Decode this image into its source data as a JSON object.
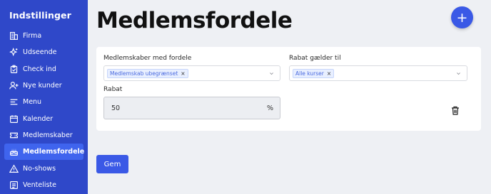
{
  "sidebar": {
    "title": "Indstillinger",
    "items": [
      {
        "label": "Firma",
        "icon": "building-icon",
        "active": false
      },
      {
        "label": "Udseende",
        "icon": "sparkle-icon",
        "active": false
      },
      {
        "label": "Check ind",
        "icon": "clipboard-check-icon",
        "active": false
      },
      {
        "label": "Nye kunder",
        "icon": "user-plus-icon",
        "active": false
      },
      {
        "label": "Menu",
        "icon": "menu-lines-icon",
        "active": false
      },
      {
        "label": "Kalender",
        "icon": "calendar-icon",
        "active": false
      },
      {
        "label": "Medlemskaber",
        "icon": "ticket-icon",
        "active": false
      },
      {
        "label": "Medlemsfordele",
        "icon": "cake-icon",
        "active": true
      },
      {
        "label": "No-shows",
        "icon": "warning-icon",
        "active": false
      },
      {
        "label": "Venteliste",
        "icon": "list-icon",
        "active": false
      }
    ]
  },
  "page": {
    "title": "Medlemsfordele",
    "add_button": "+"
  },
  "form": {
    "memberships_label": "Medlemskaber med fordele",
    "memberships_tag": "Medlemskab ubegrænset",
    "discount_scope_label": "Rabat gælder til",
    "discount_scope_tag": "Alle kurser",
    "discount_label": "Rabat",
    "discount_value": "50",
    "discount_unit": "%",
    "tag_remove": "×"
  },
  "actions": {
    "save_label": "Gem"
  },
  "colors": {
    "sidebar_bg": "#2f48c9",
    "sidebar_active": "#3f64ee",
    "accent": "#3a59e6",
    "page_bg": "#eef0f4"
  }
}
